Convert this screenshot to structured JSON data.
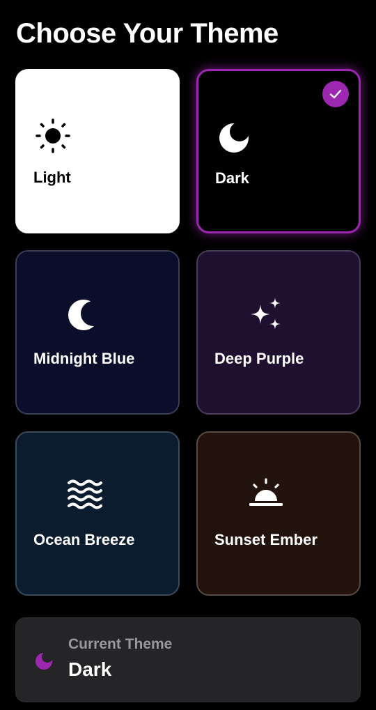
{
  "header": {
    "title": "Choose Your Theme"
  },
  "themes": [
    {
      "label": "Light",
      "icon": "sun-icon",
      "selected": false
    },
    {
      "label": "Dark",
      "icon": "moon-icon",
      "selected": true
    },
    {
      "label": "Midnight Blue",
      "icon": "crescent-moon-icon",
      "selected": false
    },
    {
      "label": "Deep Purple",
      "icon": "sparkles-icon",
      "selected": false
    },
    {
      "label": "Ocean Breeze",
      "icon": "waves-icon",
      "selected": false
    },
    {
      "label": "Sunset Ember",
      "icon": "sunset-icon",
      "selected": false
    }
  ],
  "current": {
    "label": "Current Theme",
    "value": "Dark",
    "icon": "moon-icon"
  },
  "colors": {
    "accent": "#9c27b0",
    "background": "#000000",
    "light_card": "#ffffff",
    "midnight_card": "#0b0e2a",
    "purple_card": "#1f1030",
    "ocean_card": "#0b1c2e",
    "sunset_card": "#22140c",
    "status_panel": "#252527"
  }
}
